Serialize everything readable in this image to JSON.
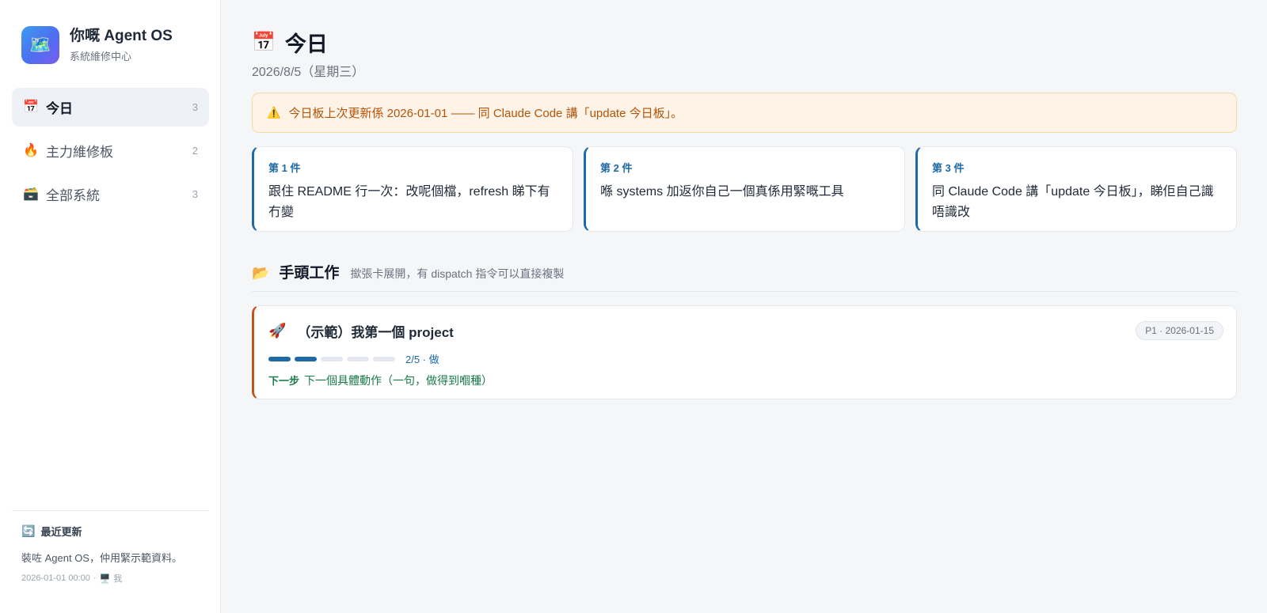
{
  "sidebar": {
    "brand": {
      "icon": "🗺️",
      "title": "你嘅 Agent OS",
      "subtitle": "系統維修中心"
    },
    "items": [
      {
        "icon": "📅",
        "label": "今日",
        "count": "3",
        "active": true
      },
      {
        "icon": "🔥",
        "label": "主力維修板",
        "count": "2",
        "active": false
      },
      {
        "icon": "🗃️",
        "label": "全部系統",
        "count": "3",
        "active": false
      }
    ],
    "recent": {
      "icon": "🔄",
      "title": "最近更新",
      "body": "裝咗 Agent OS，仲用緊示範資料。",
      "time": "2026-01-01 00:00",
      "sep": "·",
      "who_icon": "🖥️",
      "who": "我"
    }
  },
  "main": {
    "title_icon": "📅",
    "title": "今日",
    "date": "2026/8/5（星期三）",
    "alert": {
      "icon": "⚠️",
      "text": "今日板上次更新係 2026-01-01 —— 同 Claude Code 講「update 今日板」。"
    },
    "cards": [
      {
        "kicker": "第 1 件",
        "text": "跟住 README 行一次：改呢個檔，refresh 睇下有冇變"
      },
      {
        "kicker": "第 2 件",
        "text": "喺 systems 加返你自己一個真係用緊嘅工具"
      },
      {
        "kicker": "第 3 件",
        "text": "同 Claude Code 講「update 今日板」，睇佢自己識唔識改"
      }
    ],
    "section": {
      "icon": "📂",
      "title": "手頭工作",
      "hint": "撳張卡展開，有 dispatch 指令可以直接複製"
    },
    "project": {
      "icon": "🚀",
      "title": "（示範）我第一個 project",
      "badge": "P1 · 2026-01-15",
      "progress_done": 2,
      "progress_total": 5,
      "progress_label": "2/5 · 做",
      "next_label": "下一步",
      "next_text": "下一個具體動作（一句，做得到嗰種）"
    },
    "colors": {
      "accent": "#1f6aa5",
      "project_border": "#c2531a",
      "alert_text": "#b4530a",
      "next_text": "#1a7a4a"
    }
  }
}
